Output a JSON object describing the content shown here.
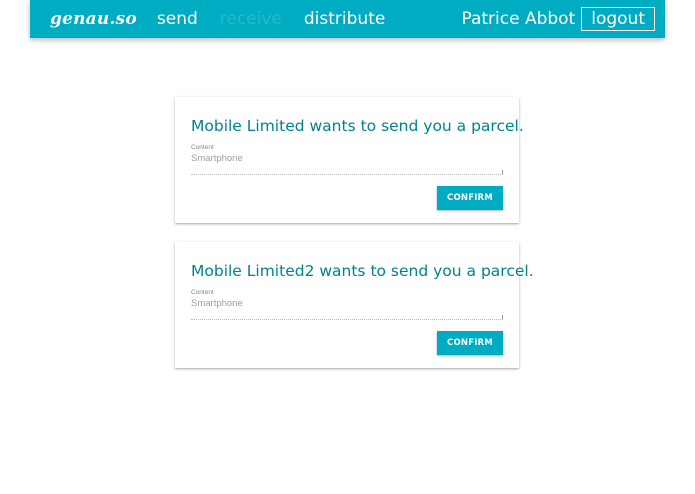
{
  "navbar": {
    "brand": "genau.so",
    "links": [
      {
        "label": "send",
        "active": false
      },
      {
        "label": "receive",
        "active": true
      },
      {
        "label": "distribute",
        "active": false
      }
    ],
    "user_name": "Patrice Abbot",
    "logout_label": "logout",
    "background_color": "#00acc1"
  },
  "parcels": [
    {
      "title": "Mobile Limited wants to send you a parcel.",
      "field_label": "Content",
      "field_value": "Smartphone",
      "confirm_label": "CONFIRM"
    },
    {
      "title": "Mobile Limited2 wants to send you a parcel.",
      "field_label": "Content",
      "field_value": "Smartphone",
      "confirm_label": "CONFIRM"
    }
  ],
  "colors": {
    "accent": "#00acc1",
    "title": "#00838f"
  }
}
